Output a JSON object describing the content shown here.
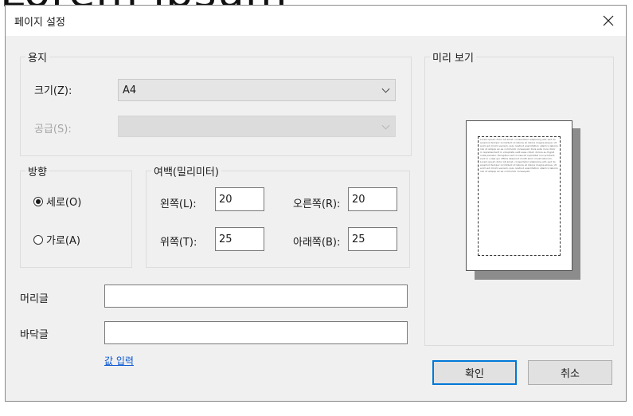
{
  "background_text": "Lorem ipsum",
  "dialog": {
    "title": "페이지 설정",
    "close_icon": "close-icon"
  },
  "paper": {
    "legend": "용지",
    "size_label": "크기(Z):",
    "size_value": "A4",
    "source_label": "공급(S):",
    "source_value": ""
  },
  "orientation": {
    "legend": "방향",
    "portrait": "세로(O)",
    "landscape": "가로(A)",
    "selected": "portrait"
  },
  "margins": {
    "legend": "여백(밀리미터)",
    "left_label": "왼쪽(L):",
    "left_value": "20",
    "right_label": "오른쪽(R):",
    "right_value": "20",
    "top_label": "위쪽(T):",
    "top_value": "25",
    "bottom_label": "아래쪽(B):",
    "bottom_value": "25"
  },
  "header_label": "머리글",
  "header_value": "",
  "footer_label": "바닥글",
  "footer_value": "",
  "enter_value_link": "값 입력",
  "preview": {
    "legend": "미리 보기",
    "sample_text": "Lorem ipsum dolor sit amet, consectetur adipiscing elit, sed do eiusmod tempor incididunt ut labore et dolore magna aliqua. Ut enim ad minim veniam, quis nostrud exercitation ullamco laboris nisi ut aliquip ex ea commodo consequat. Duis aute irure dolor in reprehenderit in voluptate velit esse cillum dolore eu fugiat nulla pariatur. Excepteur sint occaecat cupidatat non proident, sunt in culpa qui officia deserunt mollit anim id est laborum. Lorem ipsum dolor sit amet, consectetur adipiscing elit, sed do eiusmod tempor incididunt ut labore et dolore magna aliqua. Ut enim ad minim veniam, quis nostrud exercitation ullamco laboris nisi ut aliquip ex ea commodo consequat."
  },
  "buttons": {
    "ok": "확인",
    "cancel": "취소"
  },
  "colors": {
    "primary_border": "#0078d7",
    "link": "#0b57d0"
  }
}
